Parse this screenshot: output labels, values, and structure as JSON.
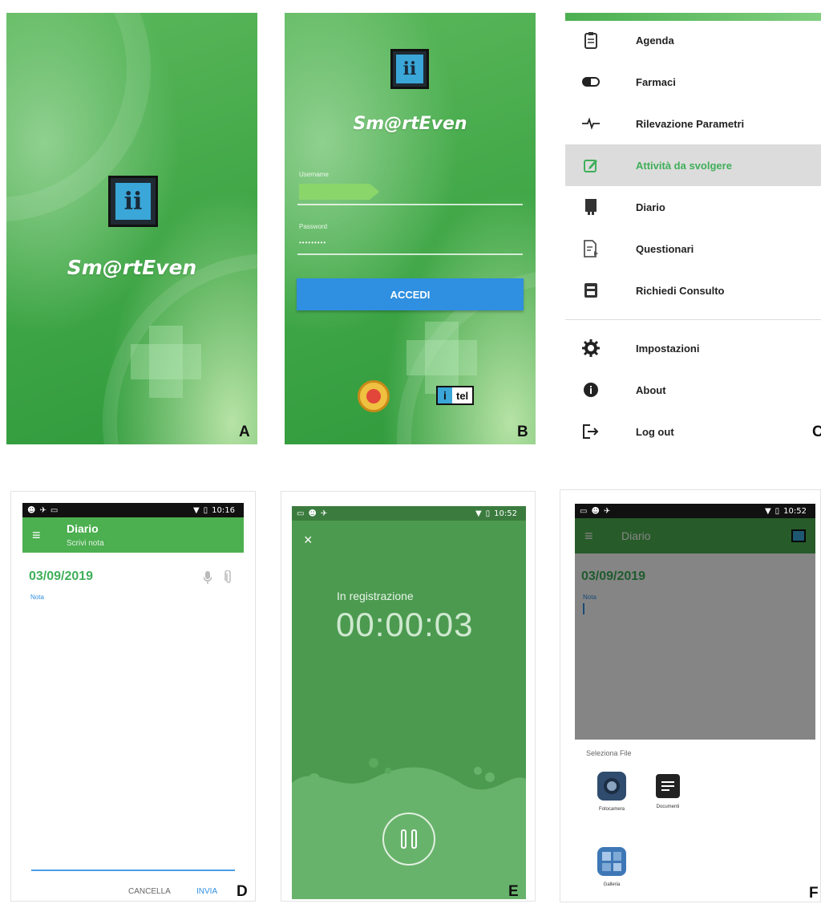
{
  "panels": {
    "a": {
      "letter": "A",
      "brand": "Sm@rtEven"
    },
    "b": {
      "letter": "B",
      "brand": "Sm@rtEven",
      "username_label": "Username",
      "password_label": "Password",
      "password_value": "•••••••••",
      "login_button": "ACCEDI",
      "partner_logo": "tel"
    },
    "c": {
      "letter": "C",
      "menu": [
        {
          "label": "Agenda",
          "icon": "clipboard-icon"
        },
        {
          "label": "Farmaci",
          "icon": "pill-icon"
        },
        {
          "label": "Rilevazione Parametri",
          "icon": "heartbeat-icon"
        },
        {
          "label": "Attività da svolgere",
          "icon": "edit-icon",
          "active": true
        },
        {
          "label": "Diario",
          "icon": "diary-icon"
        },
        {
          "label": "Questionari",
          "icon": "questionnaire-icon"
        },
        {
          "label": "Richiedi Consulto",
          "icon": "consult-icon"
        },
        {
          "label": "Impostazioni",
          "icon": "gear-icon"
        },
        {
          "label": "About",
          "icon": "info-icon"
        },
        {
          "label": "Log out",
          "icon": "logout-icon"
        }
      ]
    },
    "d": {
      "letter": "D",
      "time": "10:16",
      "title": "Diario",
      "subtitle": "Scrivi nota",
      "date": "03/09/2019",
      "note_label": "Nota",
      "cancel": "CANCELLA",
      "send": "INVIA"
    },
    "e": {
      "letter": "E",
      "time": "10:52",
      "status": "In registrazione",
      "timer": "00:00:03"
    },
    "f": {
      "letter": "F",
      "time": "10:52",
      "title": "Diario",
      "date": "03/09/2019",
      "note_label": "Nota",
      "sheet_title": "Seleziona File",
      "options": [
        "Fotocamera",
        "Documenti",
        "Galleria"
      ]
    }
  },
  "colors": {
    "green_primary": "#4caf50",
    "green_text": "#3faf5a",
    "blue_button": "#2f8fe0",
    "accent_blue": "#2f8fe0"
  }
}
